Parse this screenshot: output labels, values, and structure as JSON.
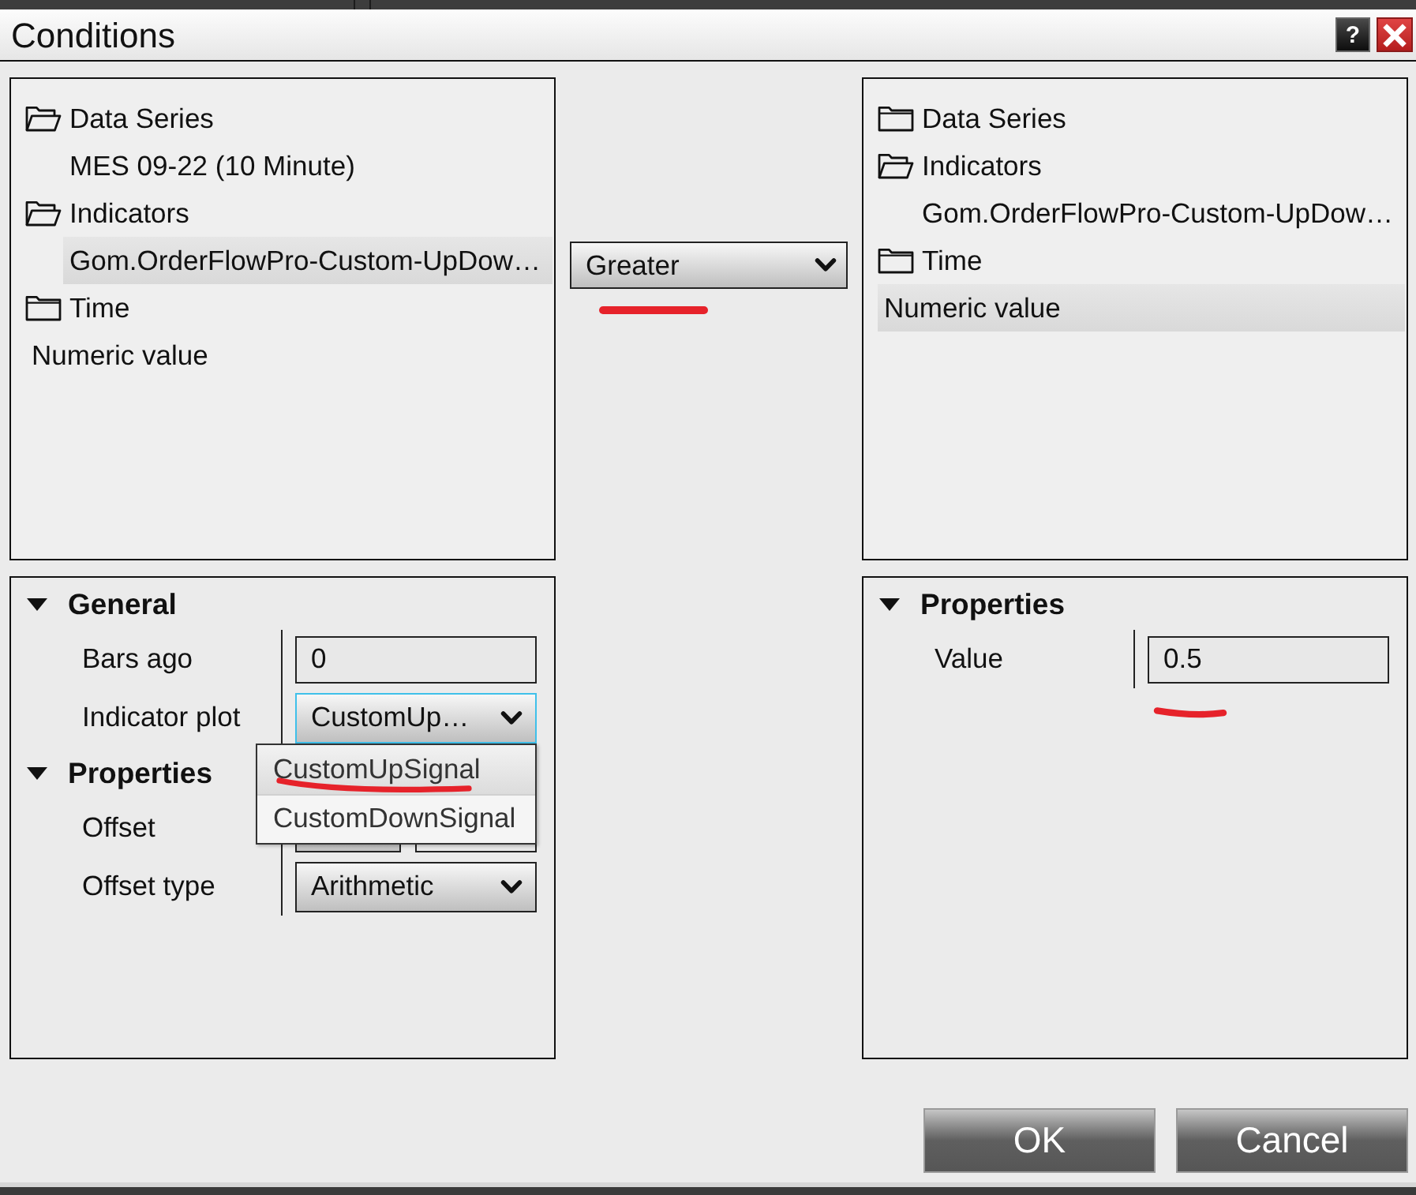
{
  "window": {
    "title": "Conditions",
    "help_label": "?"
  },
  "left_tree": [
    {
      "kind": "folder",
      "label": "Data Series",
      "expanded": true,
      "selected": false,
      "children": [
        {
          "kind": "leaf",
          "label": "MES 09-22 (10 Minute)",
          "selected": false
        }
      ]
    },
    {
      "kind": "folder",
      "label": "Indicators",
      "expanded": true,
      "selected": false,
      "children": [
        {
          "kind": "leaf",
          "label": "Gom.OrderFlowPro-Custom-UpDow…",
          "selected": true
        }
      ]
    },
    {
      "kind": "folder",
      "label": "Time",
      "expanded": false,
      "selected": false
    },
    {
      "kind": "leaf",
      "label": "Numeric value",
      "selected": false
    }
  ],
  "operator": {
    "value": "Greater",
    "marked": true
  },
  "right_tree": [
    {
      "kind": "folder",
      "label": "Data Series",
      "expanded": false,
      "selected": false
    },
    {
      "kind": "folder",
      "label": "Indicators",
      "expanded": true,
      "selected": false,
      "children": [
        {
          "kind": "leaf",
          "label": "Gom.OrderFlowPro-Custom-UpDow…",
          "selected": false
        }
      ]
    },
    {
      "kind": "folder",
      "label": "Time",
      "expanded": false,
      "selected": false
    },
    {
      "kind": "leaf",
      "label": "Numeric value",
      "selected": true
    }
  ],
  "left_properties": [
    {
      "title": "General",
      "expanded": true,
      "rows": [
        {
          "kind": "input",
          "label": "Bars ago",
          "value": "0",
          "marked": false
        },
        {
          "kind": "dropdown",
          "label": "Indicator plot",
          "value": "CustomUp…",
          "focused": true,
          "open": true,
          "marked": false,
          "options": [
            {
              "label": "CustomUpSignal",
              "selected": true,
              "marked": true
            },
            {
              "label": "CustomDownSignal",
              "selected": false,
              "marked": false
            }
          ]
        }
      ]
    },
    {
      "title": "Properties",
      "expanded": true,
      "rows": [
        {
          "kind": "split-input",
          "label": "Offset",
          "marked": false
        },
        {
          "kind": "dropdown",
          "label": "Offset type",
          "value": "Arithmetic",
          "focused": false,
          "open": false,
          "marked": false
        }
      ]
    }
  ],
  "right_properties": [
    {
      "title": "Properties",
      "expanded": true,
      "rows": [
        {
          "kind": "input",
          "label": "Value",
          "value": "0.5",
          "marked": true
        }
      ]
    }
  ],
  "buttons": [
    {
      "label": "OK"
    },
    {
      "label": "Cancel"
    }
  ]
}
